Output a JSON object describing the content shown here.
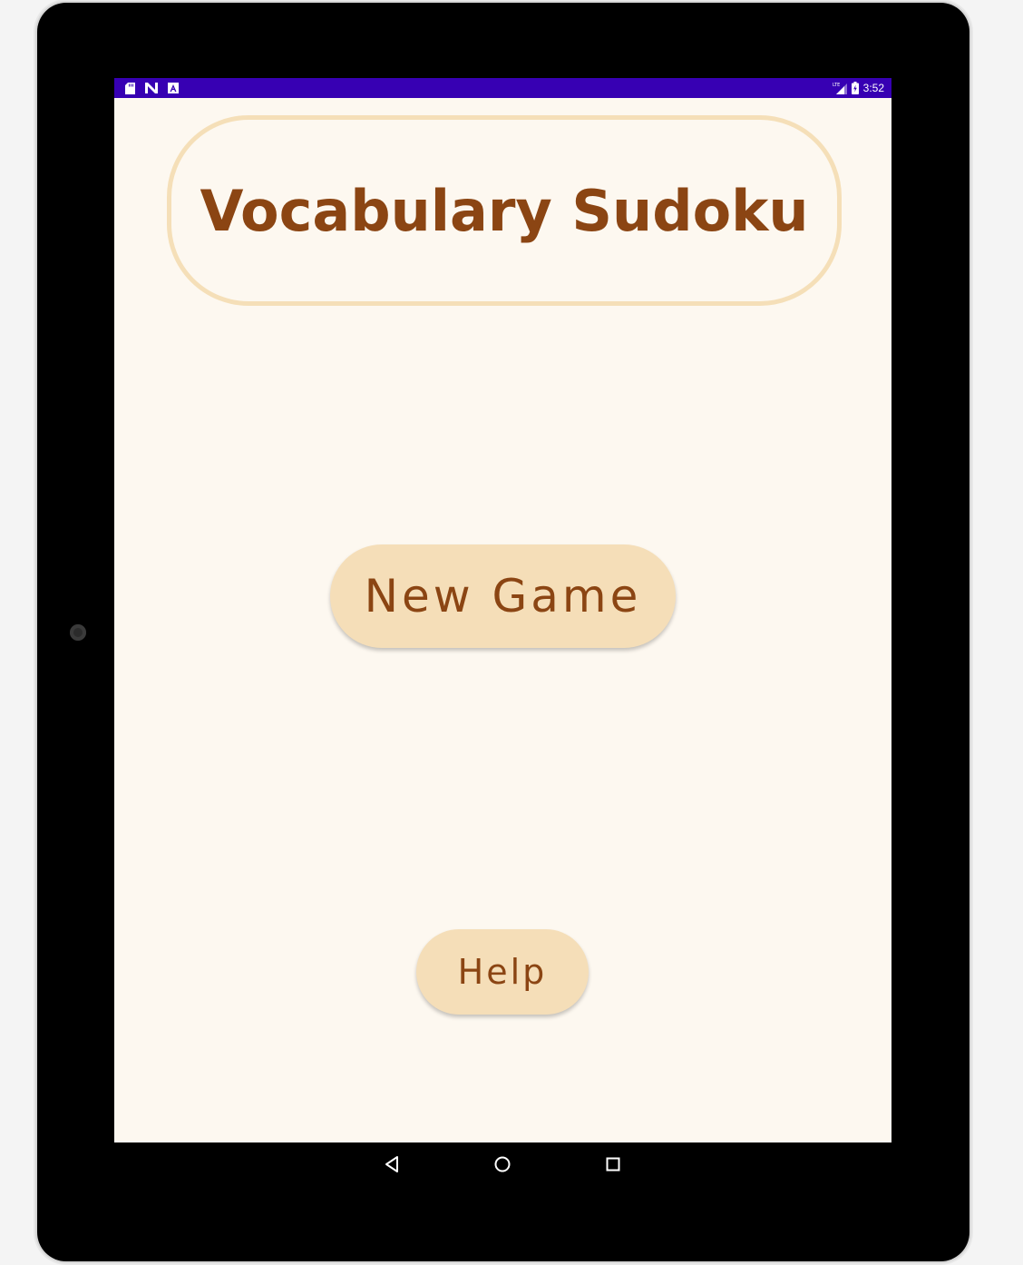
{
  "status_bar": {
    "time": "3:52",
    "left_icons": [
      "sd-card-icon",
      "n-icon",
      "a-icon"
    ],
    "right_icons": [
      "signal-lte-icon",
      "battery-charging-icon"
    ],
    "color": "#3700b3"
  },
  "app": {
    "title": "Vocabulary Sudoku",
    "new_game_label": "New Game",
    "help_label": "Help",
    "colors": {
      "background": "#fdf8f0",
      "button_bg": "#f5deb8",
      "text_brown": "#8b4513",
      "title_border": "#f5dfb8"
    }
  },
  "nav_bar": {
    "buttons": [
      "back-icon",
      "home-icon",
      "recents-icon"
    ]
  }
}
